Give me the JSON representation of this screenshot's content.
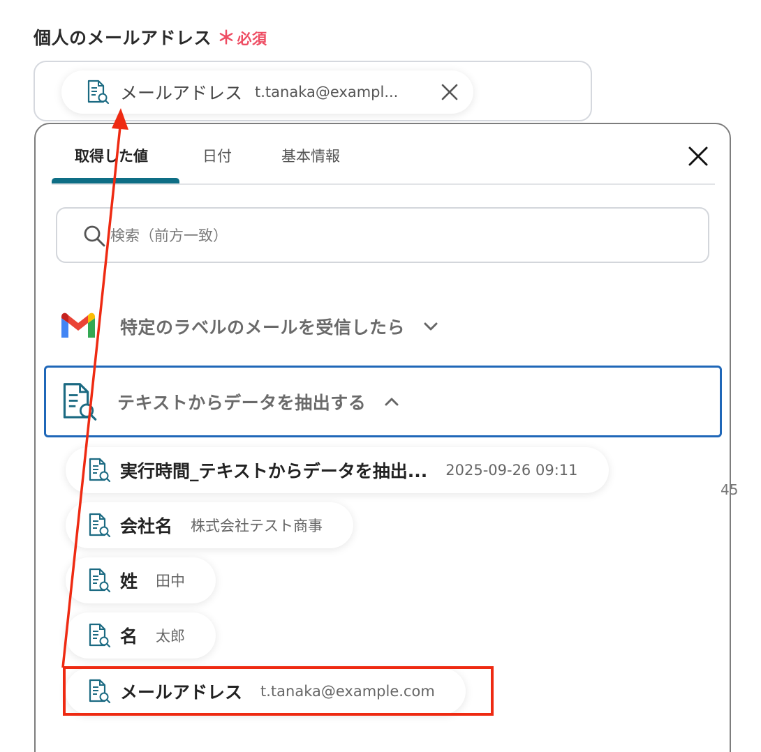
{
  "field": {
    "label": "個人のメールアドレス",
    "required_mark": "＊",
    "required_text": "必須",
    "chip": {
      "label": "メールアドレス",
      "value": "t.tanaka@exampl..."
    }
  },
  "tabs": [
    {
      "label": "取得した値",
      "active": true
    },
    {
      "label": "日付",
      "active": false
    },
    {
      "label": "基本情報",
      "active": false
    }
  ],
  "search": {
    "placeholder": "検索（前方一致）"
  },
  "sections": [
    {
      "title": "特定のラベルのメールを受信したら",
      "icon": "gmail-icon",
      "expanded": false
    },
    {
      "title": "テキストからデータを抽出する",
      "icon": "document-search-icon",
      "expanded": true
    }
  ],
  "items": [
    {
      "label": "実行時間_テキストからデータを抽出...",
      "value": "2025-09-26 09:11"
    },
    {
      "label": "会社名",
      "value": "株式会社テスト商事"
    },
    {
      "label": "姓",
      "value": "田中"
    },
    {
      "label": "名",
      "value": "太郎"
    },
    {
      "label": "メールアドレス",
      "value": "t.tanaka@example.com"
    }
  ],
  "side_text": "45",
  "colors": {
    "accent_tab": "#0e6e85",
    "required": "#ee4d63",
    "section_border": "#1f67b8",
    "annotation_red": "#ee2a12",
    "icon_teal": "#1b6a82"
  }
}
